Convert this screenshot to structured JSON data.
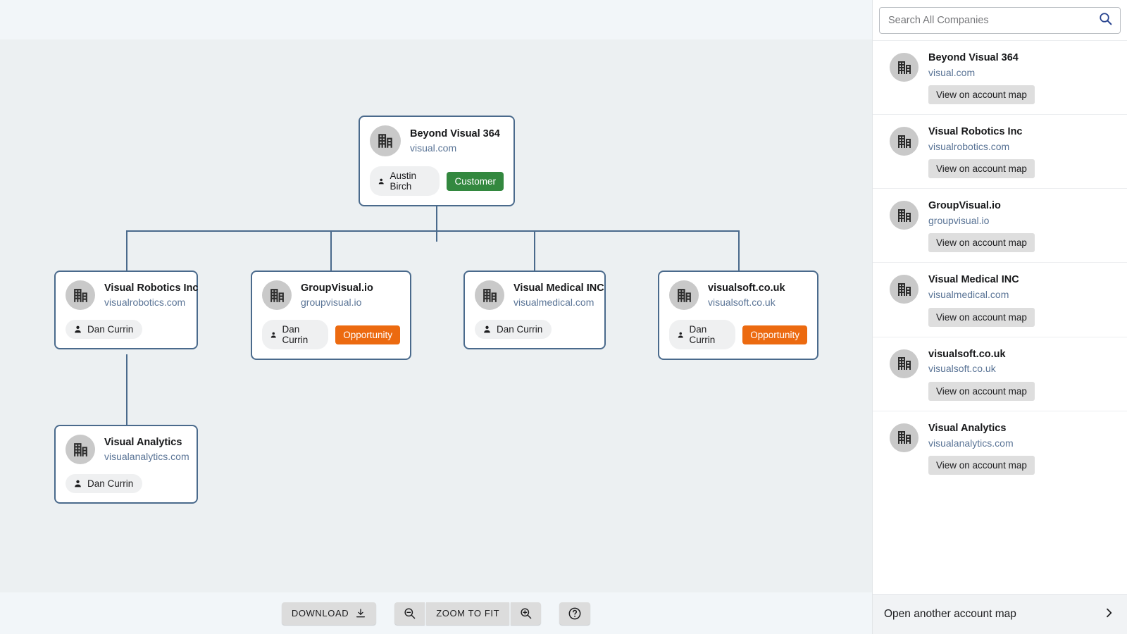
{
  "chart": {
    "root": {
      "name": "Beyond Visual 364",
      "domain": "visual.com",
      "owner": "Austin Birch",
      "badge": "Customer",
      "badge_type": "customer",
      "badge_color": "#33883f"
    },
    "children": [
      {
        "name": "Visual Robotics Inc",
        "domain": "visualrobotics.com",
        "owner": "Dan Currin",
        "badge": null
      },
      {
        "name": "GroupVisual.io",
        "domain": "groupvisual.io",
        "owner": "Dan Currin",
        "badge": "Opportunity",
        "badge_type": "opportunity",
        "badge_color": "#ec6a10"
      },
      {
        "name": "Visual Medical INC",
        "domain": "visualmedical.com",
        "owner": "Dan Currin",
        "badge": null
      },
      {
        "name": "visualsoft.co.uk",
        "domain": "visualsoft.co.uk",
        "owner": "Dan Currin",
        "badge": "Opportunity",
        "badge_type": "opportunity",
        "badge_color": "#ec6a10"
      }
    ],
    "grandchild": {
      "name": "Visual Analytics",
      "domain": "visualanalytics.com",
      "owner": "Dan Currin",
      "badge": null,
      "parent": "Visual Robotics Inc"
    },
    "connector_color": "#4a6a8c",
    "node_border_color": "#4a6a8c",
    "canvas_color": "#ecf0f2"
  },
  "toolbar": {
    "download_label": "DOWNLOAD",
    "zoom_to_fit_label": "ZOOM TO FIT",
    "zoom_out_icon": "zoom-out-icon",
    "zoom_in_icon": "zoom-in-icon",
    "help_icon": "help-circle-icon"
  },
  "sidebar": {
    "search": {
      "placeholder": "Search All Companies",
      "value": "",
      "icon": "search-icon"
    },
    "results": [
      {
        "name": "Beyond Visual 364",
        "domain": "visual.com",
        "action": "View on account map"
      },
      {
        "name": "Visual Robotics Inc",
        "domain": "visualrobotics.com",
        "action": "View on account map"
      },
      {
        "name": "GroupVisual.io",
        "domain": "groupvisual.io",
        "action": "View on account map"
      },
      {
        "name": "Visual Medical INC",
        "domain": "visualmedical.com",
        "action": "View on account map"
      },
      {
        "name": "visualsoft.co.uk",
        "domain": "visualsoft.co.uk",
        "action": "View on account map"
      },
      {
        "name": "Visual Analytics",
        "domain": "visualanalytics.com",
        "action": "View on account map"
      }
    ],
    "footer": {
      "label": "Open another account map",
      "chevron": "chevron-right-icon"
    }
  }
}
